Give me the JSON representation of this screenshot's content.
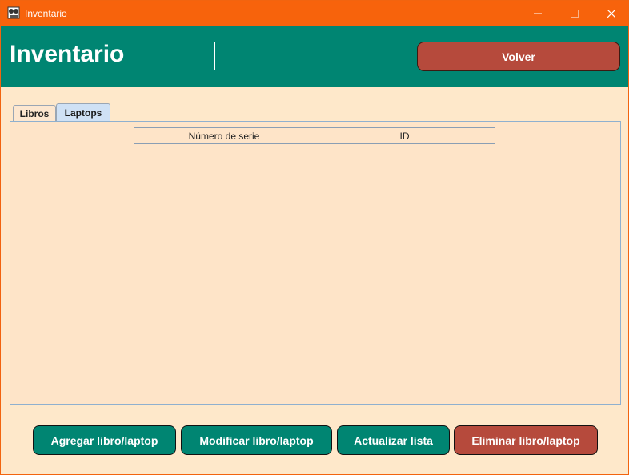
{
  "window": {
    "title": "Inventario",
    "minimize_glyph": "—",
    "maximize_glyph": "☐",
    "close_glyph": "✕"
  },
  "header": {
    "title": "Inventario",
    "back_label": "Volver"
  },
  "tabs": [
    {
      "label": "Libros",
      "selected": false
    },
    {
      "label": "Laptops",
      "selected": true
    }
  ],
  "table": {
    "columns": [
      "Número de serie",
      "ID"
    ],
    "rows": []
  },
  "actions": {
    "add_label": "Agregar libro/laptop",
    "modify_label": "Modificar libro/laptop",
    "refresh_label": "Actualizar lista",
    "delete_label": "Eliminar libro/laptop"
  },
  "colors": {
    "titlebar": "#f7630c",
    "header": "#008572",
    "background": "#fee8ca",
    "primary_button": "#008572",
    "danger_button": "#b64a3c"
  }
}
